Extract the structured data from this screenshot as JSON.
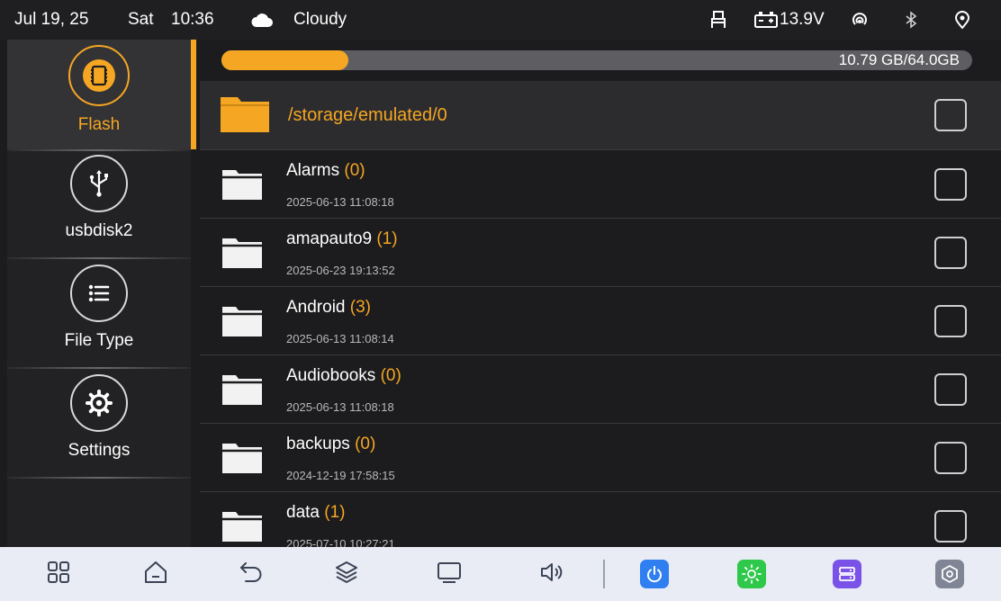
{
  "status_bar": {
    "date": "Jul 19, 25",
    "day": "Sat",
    "time": "10:36",
    "weather_icon": "cloud-icon",
    "weather": "Cloudy",
    "voltage": "13.9V"
  },
  "sidebar": {
    "items": [
      {
        "label": "Flash",
        "icon": "sd-card-icon",
        "active": true
      },
      {
        "label": "usbdisk2",
        "icon": "usb-icon",
        "active": false
      },
      {
        "label": "File Type",
        "icon": "list-icon",
        "active": false
      },
      {
        "label": "Settings",
        "icon": "gear-icon",
        "active": false
      }
    ]
  },
  "storage": {
    "used_text": "10.79 GB/64.0GB",
    "used_fraction": 0.1686
  },
  "current_path": "/storage/emulated/0",
  "files": [
    {
      "name": "Alarms",
      "count": "(0)",
      "date": "2025-06-13 11:08:18"
    },
    {
      "name": "amapauto9",
      "count": "(1)",
      "date": "2025-06-23 19:13:52"
    },
    {
      "name": "Android",
      "count": "(3)",
      "date": "2025-06-13 11:08:14"
    },
    {
      "name": "Audiobooks",
      "count": "(0)",
      "date": "2025-06-13 11:08:18"
    },
    {
      "name": "backups",
      "count": "(0)",
      "date": "2024-12-19 17:58:15"
    },
    {
      "name": "data",
      "count": "(1)",
      "date": "2025-07-10 10:27:21"
    }
  ],
  "fab": {
    "label": "+"
  },
  "nav_bar": {
    "buttons": [
      "apps-icon",
      "home-icon",
      "back-icon",
      "layers-icon",
      "screen-icon",
      "volume-icon",
      "power-icon",
      "brightness-icon",
      "storage-icon",
      "settings-hex-icon"
    ]
  },
  "colors": {
    "accent": "#f5a623",
    "background": "#1c1c1e",
    "nav_background": "#e9ecf4",
    "power": "#2f7ff0",
    "brightness": "#2ec84a",
    "storage": "#7b52e8",
    "settings": "#7f8594"
  }
}
